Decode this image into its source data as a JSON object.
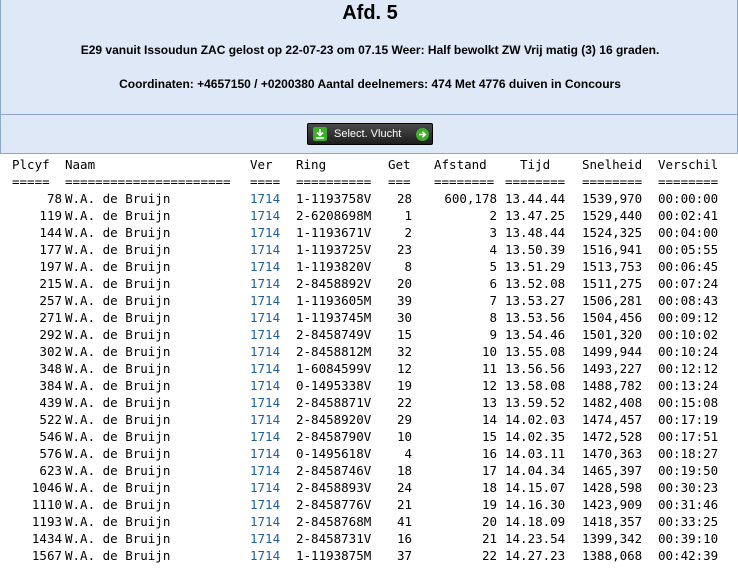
{
  "header": {
    "title": "Afd. 5",
    "line1": "E29 vanuit Issoudun ZAC gelost op 22-07-23 om 07.15 Weer: Half bewolkt ZW Vrij matig (3) 16 graden.",
    "line2": "Coordinaten: +4657150 / +0200380 Aantal deelnemers: 474 Met 4776 duiven in Concours"
  },
  "toolbar": {
    "select_label": "Select. Vlucht",
    "left_icon": "download-icon",
    "right_icon": "arrow-right-icon",
    "accent": "#3fae2a"
  },
  "table": {
    "headers": [
      "Plcyf",
      "Naam",
      "Ver",
      "Ring",
      "Get",
      "Afstand",
      "Tijd",
      "Snelheid",
      "Verschil"
    ],
    "separators": [
      "=====",
      "======================",
      "====",
      "==========",
      "===",
      "========",
      "========",
      "========",
      "========"
    ],
    "rows": [
      [
        "78",
        "W.A. de Bruijn",
        "1714",
        "1-1193758V",
        "28",
        "600,178",
        "13.44.44",
        "1539,970",
        "00:00:00"
      ],
      [
        "119",
        "W.A. de Bruijn",
        "1714",
        "2-6208698M",
        "1",
        "2",
        "13.47.25",
        "1529,440",
        "00:02:41"
      ],
      [
        "144",
        "W.A. de Bruijn",
        "1714",
        "1-1193671V",
        "2",
        "3",
        "13.48.44",
        "1524,325",
        "00:04:00"
      ],
      [
        "177",
        "W.A. de Bruijn",
        "1714",
        "1-1193725V",
        "23",
        "4",
        "13.50.39",
        "1516,941",
        "00:05:55"
      ],
      [
        "197",
        "W.A. de Bruijn",
        "1714",
        "1-1193820V",
        "8",
        "5",
        "13.51.29",
        "1513,753",
        "00:06:45"
      ],
      [
        "215",
        "W.A. de Bruijn",
        "1714",
        "2-8458892V",
        "20",
        "6",
        "13.52.08",
        "1511,275",
        "00:07:24"
      ],
      [
        "257",
        "W.A. de Bruijn",
        "1714",
        "1-1193605M",
        "39",
        "7",
        "13.53.27",
        "1506,281",
        "00:08:43"
      ],
      [
        "271",
        "W.A. de Bruijn",
        "1714",
        "1-1193745M",
        "30",
        "8",
        "13.53.56",
        "1504,456",
        "00:09:12"
      ],
      [
        "292",
        "W.A. de Bruijn",
        "1714",
        "2-8458749V",
        "15",
        "9",
        "13.54.46",
        "1501,320",
        "00:10:02"
      ],
      [
        "302",
        "W.A. de Bruijn",
        "1714",
        "2-8458812M",
        "32",
        "10",
        "13.55.08",
        "1499,944",
        "00:10:24"
      ],
      [
        "348",
        "W.A. de Bruijn",
        "1714",
        "1-6084599V",
        "12",
        "11",
        "13.56.56",
        "1493,227",
        "00:12:12"
      ],
      [
        "384",
        "W.A. de Bruijn",
        "1714",
        "0-1495338V",
        "19",
        "12",
        "13.58.08",
        "1488,782",
        "00:13:24"
      ],
      [
        "439",
        "W.A. de Bruijn",
        "1714",
        "2-8458871V",
        "22",
        "13",
        "13.59.52",
        "1482,408",
        "00:15:08"
      ],
      [
        "522",
        "W.A. de Bruijn",
        "1714",
        "2-8458920V",
        "29",
        "14",
        "14.02.03",
        "1474,457",
        "00:17:19"
      ],
      [
        "546",
        "W.A. de Bruijn",
        "1714",
        "2-8458790V",
        "10",
        "15",
        "14.02.35",
        "1472,528",
        "00:17:51"
      ],
      [
        "576",
        "W.A. de Bruijn",
        "1714",
        "0-1495618V",
        "4",
        "16",
        "14.03.11",
        "1470,363",
        "00:18:27"
      ],
      [
        "623",
        "W.A. de Bruijn",
        "1714",
        "2-8458746V",
        "18",
        "17",
        "14.04.34",
        "1465,397",
        "00:19:50"
      ],
      [
        "1046",
        "W.A. de Bruijn",
        "1714",
        "2-8458893V",
        "24",
        "18",
        "14.15.07",
        "1428,598",
        "00:30:23"
      ],
      [
        "1110",
        "W.A. de Bruijn",
        "1714",
        "2-8458776V",
        "21",
        "19",
        "14.16.30",
        "1423,909",
        "00:31:46"
      ],
      [
        "1193",
        "W.A. de Bruijn",
        "1714",
        "2-8458768M",
        "41",
        "20",
        "14.18.09",
        "1418,357",
        "00:33:25"
      ],
      [
        "1434",
        "W.A. de Bruijn",
        "1714",
        "2-8458731V",
        "16",
        "21",
        "14.23.54",
        "1399,342",
        "00:39:10"
      ],
      [
        "1567",
        "W.A. de Bruijn",
        "1714",
        "1-1193875M",
        "37",
        "22",
        "14.27.23",
        "1388,068",
        "00:42:39"
      ]
    ]
  }
}
